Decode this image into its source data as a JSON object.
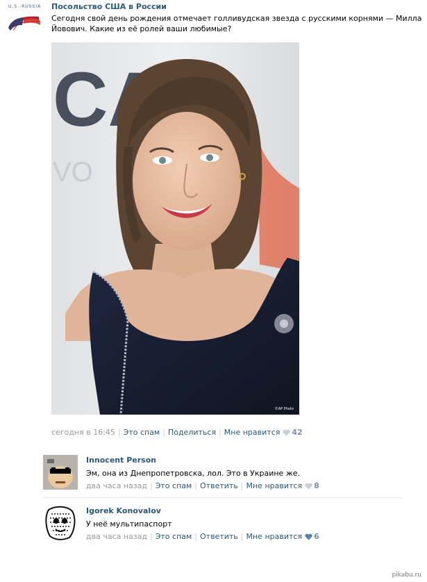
{
  "post": {
    "group_name": "Посольство США в России",
    "avatar_caption": "U.S.-RUSSIA",
    "text": "Сегодня свой день рождения отмечает голливудская звезда с русскими корнями — Милла Йовович. Какие из её ролей ваши любимые?",
    "photo_credit": "©AP Photo",
    "date": "сегодня в 16:45",
    "actions": {
      "spam": "Это спам",
      "share": "Поделиться",
      "like": "Мне нравится"
    },
    "like_count": "42"
  },
  "comments": [
    {
      "author": "Innocent Person",
      "text": "Эм, она из Днепропетровска, лол. Это в Украине же.",
      "date": "два часа назад",
      "actions": {
        "spam": "Это спам",
        "reply": "Ответить",
        "like": "Мне нравится"
      },
      "like_count": "8"
    },
    {
      "author": "Igorek Konovalov",
      "text": "У неё мультипаспорт",
      "date": "два часа назад",
      "actions": {
        "spam": "Это спам",
        "reply": "Ответить",
        "like": "Мне нравится"
      },
      "like_count": "6"
    }
  ],
  "watermark": "pikabu.ru",
  "colors": {
    "link": "#2b587a",
    "meta_gray": "#999999",
    "heart_gray": "#c6d0dc",
    "heart_blue": "#5b7fa6"
  }
}
